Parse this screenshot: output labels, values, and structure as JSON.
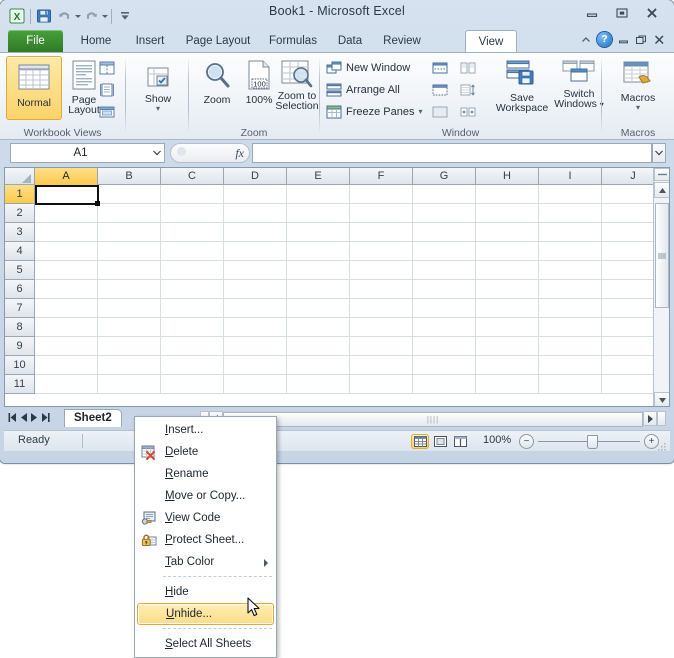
{
  "window": {
    "title": "Book1  -  Microsoft Excel",
    "quick_access": [
      {
        "name": "excel-logo-icon",
        "label": "X"
      },
      {
        "name": "save-icon",
        "label": "Save"
      },
      {
        "name": "undo-icon",
        "label": "Undo"
      },
      {
        "name": "redo-icon",
        "label": "Redo"
      },
      {
        "name": "customize-quick-access-icon",
        "label": "Customize Quick Access Toolbar"
      }
    ],
    "controls": [
      {
        "name": "minimize-button",
        "glyph": "—"
      },
      {
        "name": "maximize-button",
        "glyph": "□"
      },
      {
        "name": "close-button",
        "glyph": "✕"
      }
    ]
  },
  "ribbon": {
    "tabs": [
      {
        "label": "File",
        "active": false
      },
      {
        "label": "Home",
        "active": false
      },
      {
        "label": "Insert",
        "active": false
      },
      {
        "label": "Page Layout",
        "active": false
      },
      {
        "label": "Formulas",
        "active": false
      },
      {
        "label": "Data",
        "active": false
      },
      {
        "label": "Review",
        "active": false
      },
      {
        "label": "View",
        "active": true
      }
    ],
    "help_controls": [
      {
        "name": "minimize-ribbon-icon",
        "glyph": "⌃"
      },
      {
        "name": "help-icon",
        "glyph": "?"
      },
      {
        "name": "minimize-workbook-button",
        "glyph": "—"
      },
      {
        "name": "restore-workbook-button",
        "glyph": "❐"
      },
      {
        "name": "close-workbook-button",
        "glyph": "✕"
      }
    ],
    "groups": [
      {
        "name": "workbook-views",
        "label": "Workbook Views",
        "buttons": [
          {
            "label": "Normal",
            "selected": true
          },
          {
            "label": "Page\nLayout",
            "selected": false
          }
        ],
        "small_buttons": [
          {
            "label": "Page Break Preview"
          },
          {
            "label": "Custom Views"
          },
          {
            "label": "Full Screen"
          }
        ]
      },
      {
        "name": "show",
        "label": "",
        "buttons": [
          {
            "label": "Show",
            "selected": false
          }
        ]
      },
      {
        "name": "zoom",
        "label": "Zoom",
        "buttons": [
          {
            "label": "Zoom",
            "selected": false
          },
          {
            "label": "100%",
            "selected": false
          },
          {
            "label": "Zoom to\nSelection",
            "selected": false
          }
        ]
      },
      {
        "name": "window",
        "label": "Window",
        "small_buttons": [
          {
            "label": "New Window"
          },
          {
            "label": "Arrange All"
          },
          {
            "label": "Freeze Panes"
          }
        ],
        "buttons": [
          {
            "label": "Save\nWorkspace",
            "selected": false
          },
          {
            "label": "Switch\nWindows",
            "selected": false
          }
        ]
      },
      {
        "name": "macros",
        "label": "Macros",
        "buttons": [
          {
            "label": "Macros",
            "selected": false
          }
        ]
      }
    ],
    "labels": {
      "normal": "Normal",
      "page_layout_1": "Page",
      "page_layout_2": "Layout",
      "show": "Show",
      "zoom": "Zoom",
      "zoom100": "100%",
      "zoom_to_sel_1": "Zoom to",
      "zoom_to_sel_2": "Selection",
      "new_window": "New Window",
      "arrange_all": "Arrange All",
      "freeze_panes": "Freeze Panes",
      "save_ws_1": "Save",
      "save_ws_2": "Workspace",
      "switch_win_1": "Switch",
      "switch_win_2": "Windows",
      "macros": "Macros",
      "g_workbook_views": "Workbook Views",
      "g_zoom": "Zoom",
      "g_window": "Window",
      "g_macros": "Macros"
    }
  },
  "formula_bar": {
    "name_box_value": "A1",
    "formula_value": "",
    "fx_label": "fx",
    "cancel_glyph": "✕",
    "confirm_glyph": "✓"
  },
  "grid": {
    "columns": [
      "A",
      "B",
      "C",
      "D",
      "E",
      "F",
      "G",
      "H",
      "I",
      "J"
    ],
    "rows": [
      "1",
      "2",
      "3",
      "4",
      "5",
      "6",
      "7",
      "8",
      "9",
      "10",
      "11"
    ],
    "selected_column": "A",
    "selected_row": "1",
    "active_cell": "A1",
    "cell_values": []
  },
  "sheet_bar": {
    "nav_buttons": [
      "◀│",
      "◀",
      "▶",
      "│▶"
    ],
    "tabs": [
      {
        "label": "Sheet2",
        "active": true
      }
    ]
  },
  "status_bar": {
    "status_text": "Ready",
    "view_buttons": [
      {
        "name": "normal-view-button",
        "selected": true
      },
      {
        "name": "page-layout-view-button",
        "selected": false
      },
      {
        "name": "page-break-preview-button",
        "selected": false
      }
    ],
    "zoom_level": "100%",
    "zoom_out_glyph": "−",
    "zoom_in_glyph": "+"
  },
  "context_menu": {
    "items": [
      {
        "label": "Insert...",
        "accel": "I",
        "icon": "",
        "highlighted": false,
        "submenu": false,
        "separator_after": false
      },
      {
        "label": "Delete",
        "accel": "D",
        "icon": "delete-sheet-icon",
        "highlighted": false,
        "submenu": false,
        "separator_after": false
      },
      {
        "label": "Rename",
        "accel": "R",
        "icon": "",
        "highlighted": false,
        "submenu": false,
        "separator_after": false
      },
      {
        "label": "Move or Copy...",
        "accel": "M",
        "icon": "",
        "highlighted": false,
        "submenu": false,
        "separator_after": false
      },
      {
        "label": "View Code",
        "accel": "V",
        "icon": "view-code-icon",
        "highlighted": false,
        "submenu": false,
        "separator_after": false
      },
      {
        "label": "Protect Sheet...",
        "accel": "P",
        "icon": "protect-sheet-icon",
        "highlighted": false,
        "submenu": false,
        "separator_after": false
      },
      {
        "label": "Tab Color",
        "accel": "T",
        "icon": "",
        "highlighted": false,
        "submenu": true,
        "separator_after": true
      },
      {
        "label": "Hide",
        "accel": "H",
        "icon": "",
        "highlighted": false,
        "submenu": false,
        "separator_after": false
      },
      {
        "label": "Unhide...",
        "accel": "U",
        "icon": "",
        "highlighted": true,
        "submenu": false,
        "separator_after": true
      },
      {
        "label": "Select All Sheets",
        "accel": "S",
        "icon": "",
        "highlighted": false,
        "submenu": false,
        "separator_after": false
      }
    ]
  },
  "colors": {
    "accent_green": "#2f7a25",
    "highlight_gold": "#fbdd86",
    "highlight_border": "#e0a93c",
    "selection_header": "#fdc94a",
    "window_chrome": "#c6d4e6"
  }
}
